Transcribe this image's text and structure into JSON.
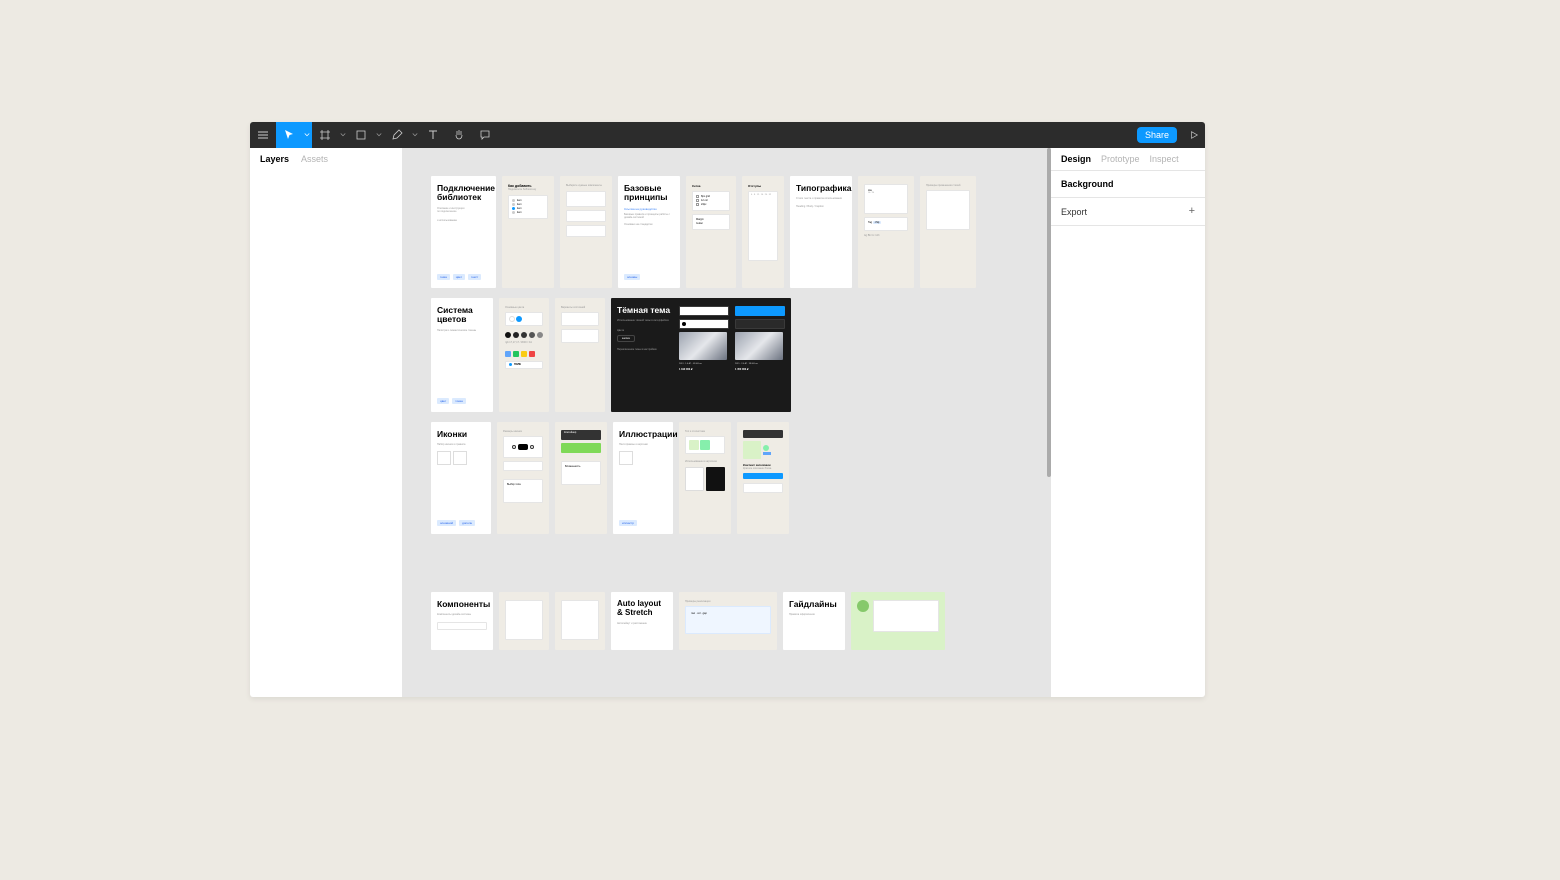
{
  "toolbar": {
    "share_label": "Share"
  },
  "left_panel": {
    "tab_layers": "Layers",
    "tab_assets": "Assets"
  },
  "right_panel": {
    "tab_design": "Design",
    "tab_prototype": "Prototype",
    "tab_inspect": "Inspect",
    "background_label": "Background",
    "export_label": "Export"
  },
  "canvas": {
    "row1": {
      "c1_title": "Подключение библиотек",
      "c1_tags": [
        "тема",
        "цвет",
        "текст"
      ],
      "c2_h1": "Как добавить",
      "c3_h1": "",
      "c4_title": "Базовые принципы",
      "c4_tag": "основы",
      "c7_title": "Типографика"
    },
    "row2": {
      "c1_title": "Система цветов",
      "c4_title": "Тёмная тема"
    },
    "row3": {
      "c1_title": "Иконки",
      "c4_title": "Иллюстрации",
      "c1_tags": [
        "основной",
        "дополн"
      ]
    },
    "row4": {
      "c1_title": "Компоненты",
      "c4_title": "Auto layout & Stretch",
      "c7_title": "Гайдлайны"
    }
  }
}
